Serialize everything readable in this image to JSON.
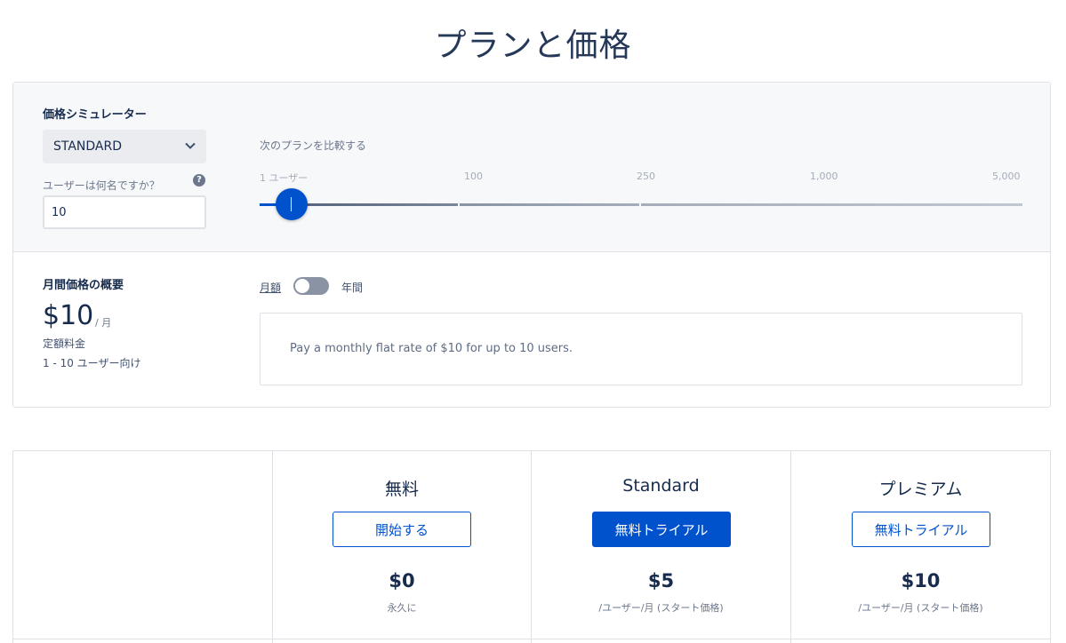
{
  "page": {
    "title": "プランと価格"
  },
  "simulator": {
    "heading": "価格シミュレーター",
    "plan_select": {
      "value": "STANDARD",
      "icon": "chevron-down-icon"
    },
    "users_label": "ユーザーは何名ですか？",
    "help_icon": "?",
    "users_value": "10",
    "compare_label": "次のプランを比較する",
    "ticks": [
      "1 ユーザー",
      "100",
      "250",
      "1,000",
      "5,000"
    ],
    "slider_value": 10,
    "accent_color": "#0052cc"
  },
  "summary": {
    "heading": "月間価格の概要",
    "price": "$10",
    "price_unit": "/ 月",
    "flat_label": "定額料金",
    "range_label": "1 - 10 ユーザー向け",
    "toggle_monthly": "月額",
    "toggle_yearly": "年間",
    "toggle_on": false,
    "description": "Pay a monthly flat rate of $10 for up to 10 users."
  },
  "plans": [
    {
      "name": "無料",
      "button": "開始する",
      "button_style": "outline",
      "price": "$0",
      "note": "永久に"
    },
    {
      "name": "Standard",
      "button": "無料トライアル",
      "button_style": "solid",
      "price": "$5",
      "note": "/ユーザー/月 (スタート価格)"
    },
    {
      "name": "プレミアム",
      "button": "無料トライアル",
      "button_style": "outline",
      "price": "$10",
      "note": "/ユーザー/月 (スタート価格)"
    }
  ]
}
